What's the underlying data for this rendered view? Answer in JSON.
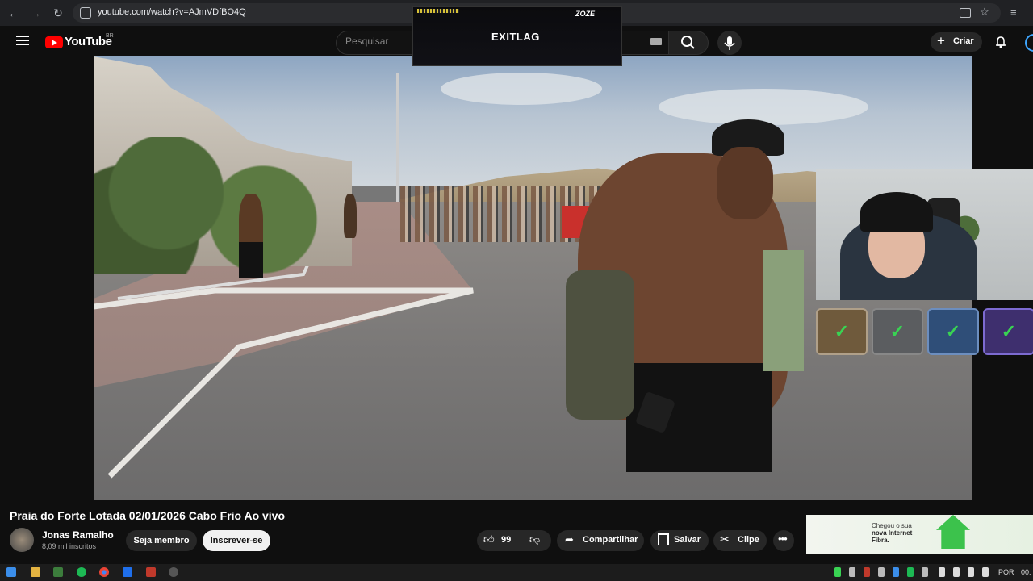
{
  "browser": {
    "url": "youtube.com/watch?v=AJmVDfBO4Q"
  },
  "youtube": {
    "logo_text": "YouTube",
    "region_badge": "BR",
    "search_placeholder": "Pesquisar",
    "create_label": "Criar"
  },
  "overlay": {
    "brand": "EXITLAG",
    "partner": "ZOZE"
  },
  "video": {
    "title": "Praia do Forte Lotada 02/01/2026 Cabo Frio Ao vivo",
    "channel_name": "Jonas Ramalho",
    "subscribers": "8,09 mil inscritos",
    "member_label": "Seja membro",
    "subscribe_label": "Inscrever-se",
    "like_count": "99",
    "share_label": "Compartilhar",
    "save_label": "Salvar",
    "clip_label": "Clipe"
  },
  "ad": {
    "line1": "Chegou o sua",
    "line2": "nova Internet",
    "line3": "Fibra."
  },
  "taskbar": {
    "language": "POR",
    "time": "00:"
  },
  "colors": {
    "youtube_red": "#ff0000",
    "check_green": "#39d353",
    "accent_blue": "#3ea6ff"
  }
}
